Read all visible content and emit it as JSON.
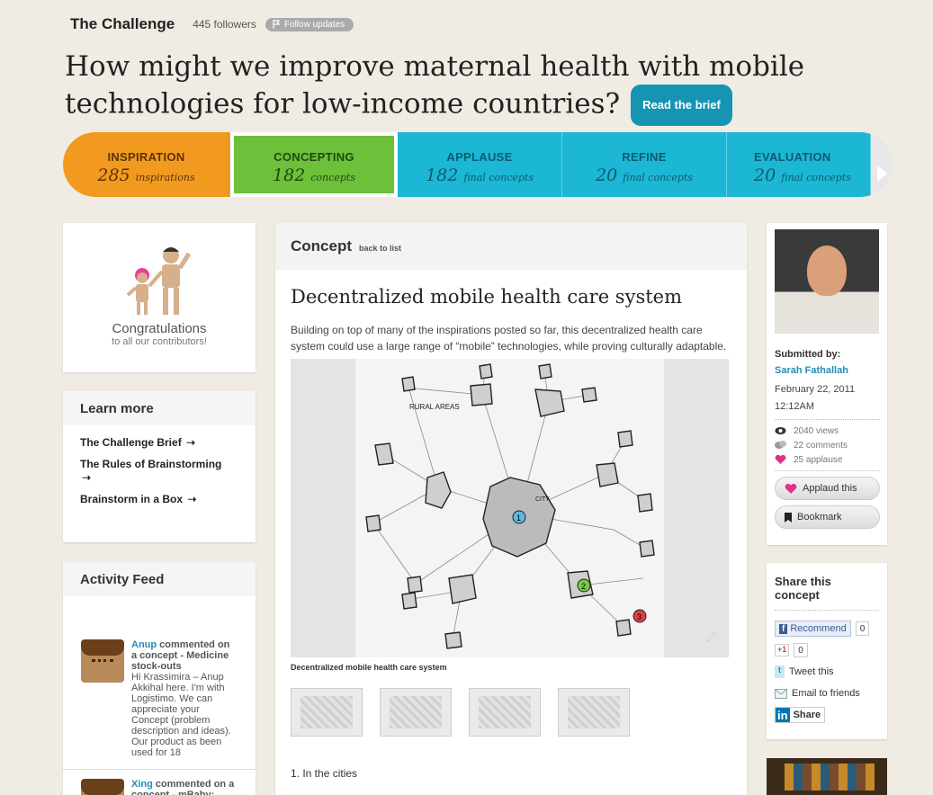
{
  "header": {
    "challenge_label": "The Challenge",
    "followers": "445 followers",
    "follow_button": "Follow updates",
    "question": "How might we improve maternal health with mobile technologies for low-income countries?",
    "read_brief": "Read the brief"
  },
  "stages": [
    {
      "name": "INSPIRATION",
      "number": "285",
      "unit": "inspirations",
      "color": "#f29a1f"
    },
    {
      "name": "CONCEPTING",
      "number": "182",
      "unit": "concepts",
      "color": "#6cc03a"
    },
    {
      "name": "APPLAUSE",
      "number": "182",
      "unit": "final concepts",
      "color": "#1cb7d4"
    },
    {
      "name": "REFINE",
      "number": "20",
      "unit": "final concepts",
      "color": "#1cb7d4"
    },
    {
      "name": "EVALUATION",
      "number": "20",
      "unit": "final concepts",
      "color": "#1cb7d4"
    }
  ],
  "congrats": {
    "title": "Congratulations",
    "subtitle": "to all our contributors!"
  },
  "learn_more": {
    "title": "Learn more",
    "links": [
      "The Challenge Brief",
      "The Rules of Brainstorming",
      "Brainstorm in a Box"
    ]
  },
  "activity": {
    "title": "Activity Feed",
    "items": [
      {
        "user": "Anup",
        "action": " commented on a concept - Medicine stock-outs",
        "text": "Hi Krassimira – Anup Akkihal here. I'm with Logistimo. We can appreciate your Concept (problem description and ideas). Our product as been used for 18"
      },
      {
        "user": "Xing",
        "action": " commented on a concept - mBaby: Making Information Actionable",
        "text": ""
      }
    ]
  },
  "concept": {
    "heading": "Concept",
    "back": "back to list",
    "title": "Decentralized mobile health care system",
    "description": "Building on top of many of the inspirations posted so far, this decentralized health care system could use a large range of “mobile” technologies, while proving culturally adaptable.",
    "sketch_labels": {
      "rural": "RURAL AREAS",
      "city": "CITY",
      "n1": "1",
      "n2": "2",
      "n3": "3"
    },
    "caption": "Decentralized mobile health care system",
    "list_start": "1. In the cities"
  },
  "author": {
    "submitted_label": "Submitted by:",
    "name": "Sarah Fathallah",
    "date": "February 22, 2011",
    "time": "12:12AM",
    "views": "2040 views",
    "comments": "22 comments",
    "applause": "25 applause",
    "applaud_btn": "Applaud this",
    "bookmark_btn": "Bookmark"
  },
  "share": {
    "title": "Share this concept",
    "fb_label": "Recommend",
    "fb_count": "0",
    "g_label": "+1",
    "g_count": "0",
    "tweet": "Tweet this",
    "email": "Email to friends",
    "linkedin_logo": "in",
    "linkedin": "Share"
  },
  "colors": {
    "accent": "#1f8fb7",
    "brief_button": "#1594b4",
    "heart": "#e0308a"
  }
}
